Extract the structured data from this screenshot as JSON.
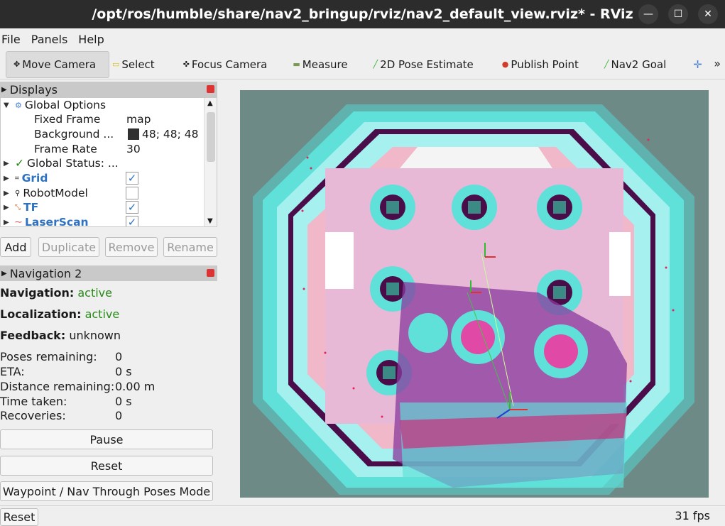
{
  "window": {
    "title": "/opt/ros/humble/share/nav2_bringup/rviz/nav2_default_view.rviz* - RViz"
  },
  "menu": [
    "File",
    "Panels",
    "Help"
  ],
  "toolbar": {
    "move_camera": "Move Camera",
    "select": "Select",
    "focus_camera": "Focus Camera",
    "measure": "Measure",
    "pose_estimate": "2D Pose Estimate",
    "publish_point": "Publish Point",
    "nav2_goal": "Nav2 Goal",
    "more": "»"
  },
  "displays": {
    "header": "Displays",
    "global_options": "Global Options",
    "fixed_frame_label": "Fixed Frame",
    "fixed_frame_value": "map",
    "background_label": "Background ...",
    "background_value": "48; 48; 48",
    "frame_rate_label": "Frame Rate",
    "frame_rate_value": "30",
    "global_status": "Global Status: ...",
    "items": [
      {
        "label": "Grid",
        "checked": true
      },
      {
        "label": "RobotModel",
        "checked": false
      },
      {
        "label": "TF",
        "checked": true
      },
      {
        "label": "LaserScan",
        "checked": true
      }
    ],
    "buttons": {
      "add": "Add",
      "duplicate": "Duplicate",
      "remove": "Remove",
      "rename": "Rename"
    }
  },
  "navigation": {
    "header": "Navigation 2",
    "navigation_label": "Navigation:",
    "navigation_value": "active",
    "localization_label": "Localization:",
    "localization_value": "active",
    "feedback_label": "Feedback:",
    "feedback_value": "unknown",
    "poses_label": "Poses remaining:",
    "poses_value": "0",
    "eta_label": "ETA:",
    "eta_value": "0 s",
    "distance_label": "Distance remaining:",
    "distance_value": "0.00 m",
    "time_label": "Time taken:",
    "time_value": "0 s",
    "recoveries_label": "Recoveries:",
    "recoveries_value": "0",
    "pause": "Pause",
    "reset": "Reset",
    "waypoint_mode": "Waypoint / Nav Through Poses Mode"
  },
  "statusbar": {
    "reset": "Reset",
    "fps": "31 fps"
  },
  "colors": {
    "background_swatch": "#303030",
    "active": "#2a8a18",
    "display_blue": "#2f72c1"
  }
}
